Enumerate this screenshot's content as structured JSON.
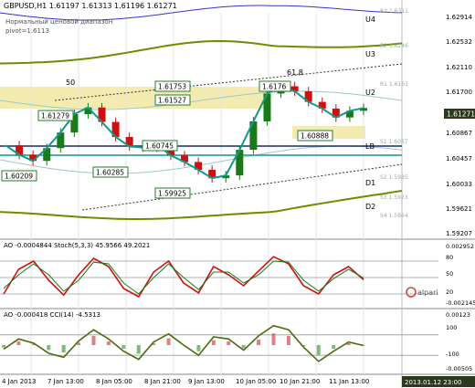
{
  "header": {
    "symbol_line": "GBPUSD,H1  1.61197 1.61313 1.61196 1.61271",
    "indicator_name": "Нормальный ценовой диапазон",
    "pivot_label": "pivot=1.6113"
  },
  "colors": {
    "background": "#ffffff",
    "bull_candle": "#1a7a1a",
    "bear_candle": "#cc1111",
    "ma_teal": "#11998a",
    "ma_navy": "#1a2a6a",
    "band_olive": "#6b8e00",
    "band_blue": "#3333cc",
    "resistance_zone": "#f3e9a8",
    "stoch_main": "#cc1111",
    "stoch_signal": "#1a7a1a",
    "cci_line": "#4a6a10",
    "current_price_box": "#2a3a1a"
  },
  "price_axis": {
    "ticks": [
      "1.62914",
      "1.62532",
      "1.62110",
      "1.61700",
      "1.61271",
      "1.60867",
      "1.60457",
      "1.60033",
      "1.59621",
      "1.59207"
    ],
    "current_price": "1.61271"
  },
  "time_axis": {
    "ticks": [
      "4 Jan 2013",
      "7 Jan 13:00",
      "8 Jan 05:00",
      "8 Jan 21:00",
      "9 Jan 13:00",
      "10 Jan 05:00",
      "10 Jan 21:00",
      "11 Jan 13:00"
    ],
    "end_label": "2013.01.12 23:00"
  },
  "zone_labels": [
    "U4",
    "U3",
    "U2",
    "LB",
    "D1",
    "D2"
  ],
  "pivot_levels": [
    "R3 1.6311",
    "R2 1.6246",
    "R1 1.6161",
    "S1 1.6057",
    "S2 1.5985",
    "S3 1.5923",
    "S4 1.5864"
  ],
  "price_labels": [
    {
      "text": "1.61753"
    },
    {
      "text": "1.61527"
    },
    {
      "text": "1.61279"
    },
    {
      "text": "1.60745"
    },
    {
      "text": "1.60285"
    },
    {
      "text": "1.59925"
    },
    {
      "text": "1.60209"
    },
    {
      "text": "1.6176"
    },
    {
      "text": "1.60888"
    }
  ],
  "annotations": [
    "50",
    "61.8"
  ],
  "stoch_panel": {
    "title": "AO -0.0004844  Stoch(5,3,3) 45.9566 49.2021",
    "axis_ticks": [
      "0.002952",
      "80",
      "50",
      "20",
      "-0.002145"
    ]
  },
  "cci_panel": {
    "title": "AO -0.000418  CCI(14) -4.5313",
    "axis_ticks": [
      "0.00123",
      "100",
      "-100",
      "-0.00505"
    ]
  },
  "watermark": "alpari",
  "chart_data": [
    {
      "type": "line",
      "title": "GBPUSD,H1",
      "series": [
        {
          "values": [
            1.6062,
            1.6045,
            1.6034,
            1.6057,
            1.6085,
            1.6118,
            1.613,
            1.6104,
            1.6077,
            1.606,
            1.6058,
            1.6063,
            1.6044,
            1.6032,
            1.6018,
            1.6003,
            1.6008,
            1.6054,
            1.6105,
            1.6155,
            1.6168,
            1.6159,
            1.614,
            1.6128,
            1.6112,
            1.6124,
            1.6129
          ]
        }
      ],
      "ylim": [
        1.59,
        1.63
      ]
    },
    {
      "type": "line",
      "title": "AO -0.0004844  Stoch(5,3,3) 45.9566 49.2021",
      "series": [
        {
          "values": [
            20,
            65,
            80,
            45,
            18,
            55,
            85,
            70,
            30,
            15,
            60,
            80,
            40,
            22,
            70,
            55,
            35,
            62,
            88,
            75,
            35,
            20,
            55,
            70,
            46
          ]
        },
        {
          "values": [
            30,
            55,
            75,
            55,
            25,
            45,
            78,
            75,
            40,
            20,
            50,
            75,
            50,
            28,
            60,
            60,
            40,
            55,
            80,
            78,
            45,
            25,
            48,
            65,
            49
          ]
        }
      ],
      "ylim": [
        0,
        100
      ]
    },
    {
      "type": "line",
      "title": "AO -0.000418  CCI(14) -4.5313",
      "series": [
        {
          "values": [
            -40,
            60,
            20,
            -80,
            -120,
            40,
            150,
            60,
            -60,
            -140,
            30,
            110,
            0,
            -100,
            80,
            60,
            -50,
            90,
            190,
            150,
            -20,
            -160,
            -60,
            30,
            -4.5
          ]
        }
      ],
      "ylim": [
        -250,
        250
      ]
    }
  ]
}
